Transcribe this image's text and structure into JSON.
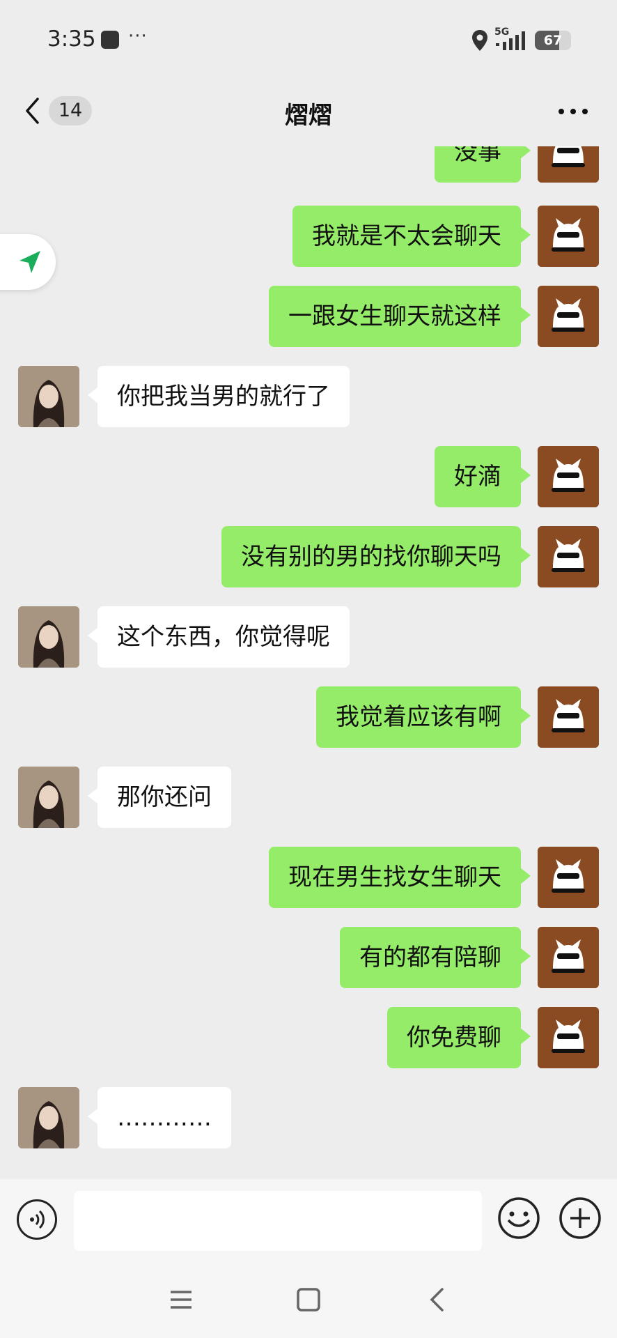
{
  "status_bar": {
    "time": "3:35",
    "overflow": "···",
    "network": "5G",
    "battery": "67",
    "battery_level": 0.67
  },
  "header": {
    "unread_count": "14",
    "title": "熠熠"
  },
  "messages": [
    {
      "side": "me",
      "text": "没事"
    },
    {
      "side": "me",
      "text": "我就是不太会聊天"
    },
    {
      "side": "me",
      "text": "一跟女生聊天就这样"
    },
    {
      "side": "other",
      "text": "你把我当男的就行了"
    },
    {
      "side": "me",
      "text": "好滴"
    },
    {
      "side": "me",
      "text": "没有别的男的找你聊天吗"
    },
    {
      "side": "other",
      "text": "这个东西，你觉得呢"
    },
    {
      "side": "me",
      "text": "我觉着应该有啊"
    },
    {
      "side": "other",
      "text": "那你还问"
    },
    {
      "side": "me",
      "text": "现在男生找女生聊天"
    },
    {
      "side": "me",
      "text": "有的都有陪聊"
    },
    {
      "side": "me",
      "text": "你免费聊"
    },
    {
      "side": "other",
      "text": "…………"
    }
  ],
  "input": {
    "value": "",
    "placeholder": ""
  },
  "colors": {
    "my_bubble": "#95ec69",
    "other_bubble": "#ffffff",
    "background": "#ededed",
    "cat_avatar": "#8a4b22"
  },
  "icons": {
    "back": "chevron-left-icon",
    "more": "more-icon",
    "voice": "voice-icon",
    "emoji": "emoji-icon",
    "plus": "plus-icon",
    "location": "location-arrow-icon"
  }
}
